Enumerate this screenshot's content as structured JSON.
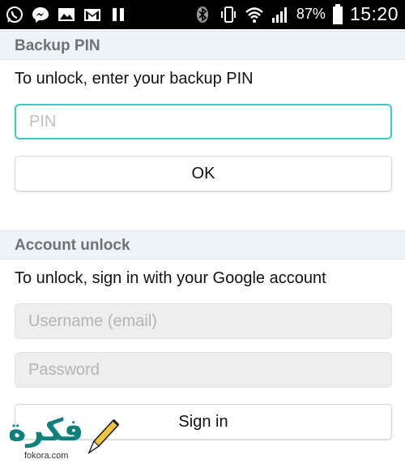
{
  "status_bar": {
    "icons_left": [
      "whatsapp-icon",
      "messenger-icon",
      "gallery-icon",
      "gmail-icon",
      "pause-icon"
    ],
    "icons_right": [
      "bluetooth-icon",
      "vibrate-icon",
      "wifi-icon",
      "signal-icon"
    ],
    "battery_percent": "87%",
    "time": "15:20",
    "colors": {
      "background": "#000000",
      "foreground": "#ffffff"
    }
  },
  "backup_pin": {
    "header": "Backup PIN",
    "instruction": "To unlock, enter your backup PIN",
    "pin_placeholder": "PIN",
    "pin_value": "",
    "ok_label": "OK"
  },
  "account_unlock": {
    "header": "Account unlock",
    "instruction": "To unlock, sign in with your Google account",
    "username_placeholder": "Username (email)",
    "password_placeholder": "Password",
    "sign_in_label": "Sign in"
  },
  "watermark": {
    "logo_text": "فكرة",
    "domain": "fokora.com"
  },
  "colors": {
    "accent": "#3ec9c6",
    "section_header_bg": "#eef3f7",
    "disabled_field_bg": "#eeeeee"
  }
}
